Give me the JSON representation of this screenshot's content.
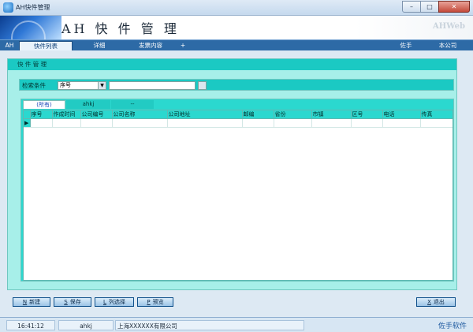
{
  "window": {
    "title": "AH快件管理",
    "minimize": "–",
    "maximize": "□",
    "close": "✕"
  },
  "banner": {
    "title": "AH 快 件 管 理",
    "brand": "AHWeb"
  },
  "tabs": {
    "home": "AH",
    "items": [
      {
        "label": "快件列表",
        "active": true
      },
      {
        "label": "详细"
      },
      {
        "label": "发票内容"
      },
      {
        "label": "+"
      }
    ],
    "right": [
      "佐手",
      "本公司"
    ]
  },
  "panel": {
    "title": "快 件 管 理",
    "search": {
      "label": "检索条件",
      "field": "序号",
      "value": ""
    },
    "grid_tabs": [
      {
        "label": "(所有)",
        "active": true
      },
      {
        "label": "ahkj"
      },
      {
        "label": "--"
      }
    ],
    "columns": [
      "序号",
      "作成时间",
      "公司编号",
      "公司名称",
      "公司地址",
      "邮编",
      "省份",
      "市镇",
      "区号",
      "电话",
      "传真"
    ],
    "row_indicator": "▶"
  },
  "buttons": [
    {
      "key": "N",
      "label": "新建"
    },
    {
      "key": "S",
      "label": "保存"
    },
    {
      "key": "L",
      "label": "列选择"
    },
    {
      "key": "P",
      "label": "预览"
    },
    {
      "key": "X",
      "label": "退出"
    }
  ],
  "status": {
    "time": "16:41:12",
    "user": "ahkj",
    "company": "上海XXXXXX有限公司",
    "logo": "佐手软件"
  }
}
